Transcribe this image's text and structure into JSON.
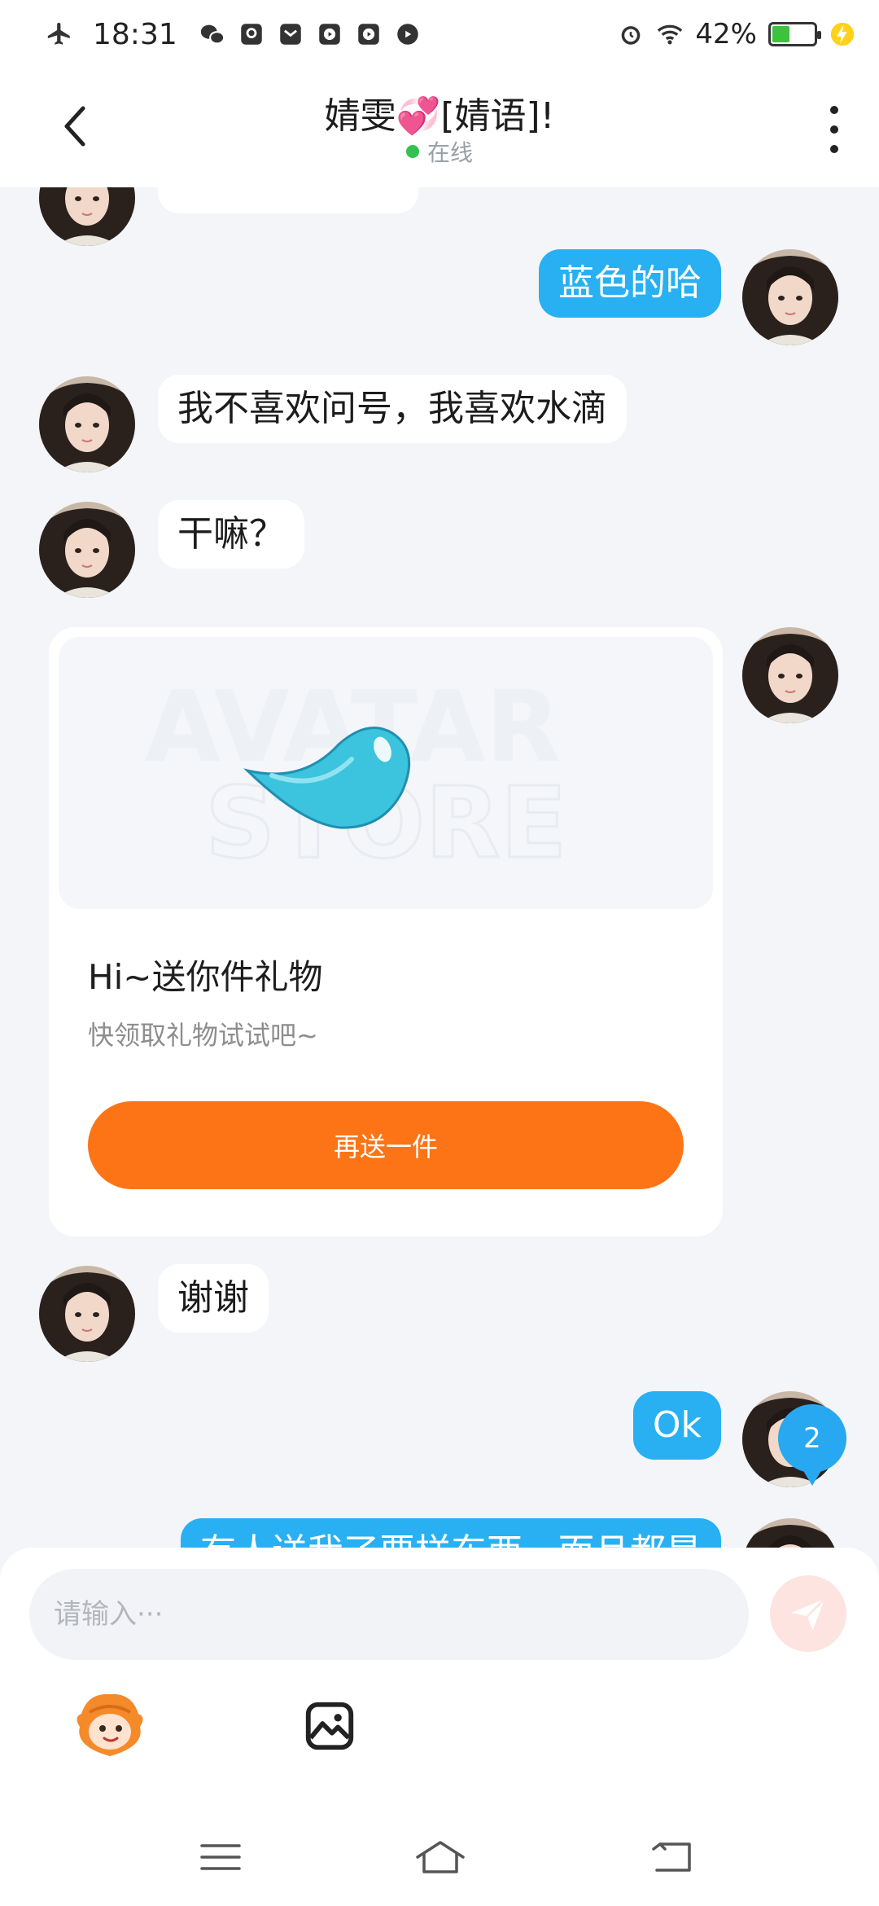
{
  "status_bar": {
    "time": "18:31",
    "battery_percent": "42%",
    "battery_level": 0.42,
    "icons": [
      "airplane-icon",
      "wechat-icon",
      "qq-icon",
      "mail-icon",
      "video-app-icon",
      "video-app-icon",
      "chat-app-icon",
      "alarm-icon",
      "wifi-icon",
      "battery-icon",
      "charging-icon"
    ]
  },
  "header": {
    "title": "婧雯💞[婧语]!",
    "status": "在线"
  },
  "messages": [
    {
      "side": "in",
      "text": ""
    },
    {
      "side": "out",
      "text": "蓝色的哈"
    },
    {
      "side": "in",
      "text": "我不喜欢问号，我喜欢水滴"
    },
    {
      "side": "in",
      "text": "干嘛？"
    },
    {
      "side": "out",
      "type": "gift"
    },
    {
      "side": "in",
      "text": "谢谢"
    },
    {
      "side": "out",
      "text": "Ok"
    },
    {
      "side": "out",
      "text": "有人送我了要样东西，而且都是"
    }
  ],
  "gift": {
    "watermark_line1": "AVATAR",
    "watermark_line2": "STORE",
    "title": "Hi~送你件礼物",
    "subtitle": "快领取礼物试试吧~",
    "button_label": "再送一件"
  },
  "unread_count": "2",
  "input": {
    "placeholder": "请输入···"
  },
  "colors": {
    "outgoing_bubble": "#28b0f2",
    "gift_button": "#fd7416",
    "online_dot": "#33c24d",
    "background": "#f3f5f9"
  }
}
